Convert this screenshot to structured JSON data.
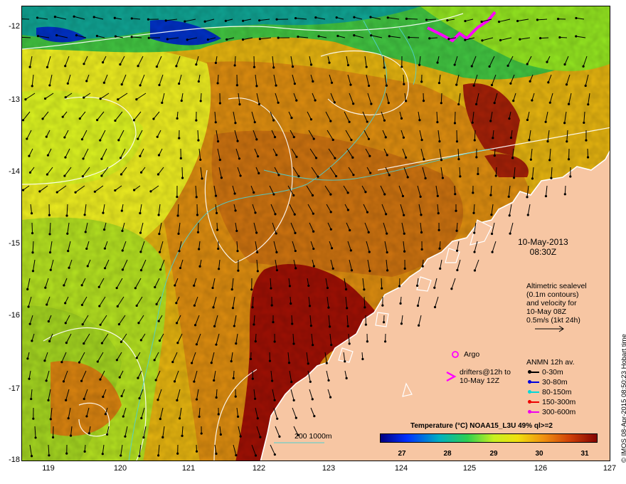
{
  "axes": {
    "y_ticks": [
      "-12",
      "-13",
      "-14",
      "-15",
      "-16",
      "-17",
      "-18"
    ],
    "x_ticks": [
      "119",
      "120",
      "121",
      "122",
      "123",
      "124",
      "125",
      "126",
      "127"
    ]
  },
  "date": "10-May-2013",
  "time": "08:30Z",
  "altimetry_lines": [
    "Altimetric sealevel",
    "(0.1m contours)",
    "and velocity for",
    "10-May 08Z",
    "0.5m/s (1kt 24h)"
  ],
  "argo_label": "Argo",
  "drifters_lines": [
    "drifters@12h to",
    "10-May 12Z"
  ],
  "anmn_title": "ANMN 12h av.",
  "anmn_legend": [
    {
      "label": "0-30m",
      "color": "#000000"
    },
    {
      "label": "30-80m",
      "color": "#0000dd"
    },
    {
      "label": "80-150m",
      "color": "#00d8d8"
    },
    {
      "label": "150-300m",
      "color": "#ee0000"
    },
    {
      "label": "300-600m",
      "color": "#ee00ee"
    }
  ],
  "isobath_label": "200  1000m",
  "colorbar": {
    "title": "Temperature (°C) NOAA15_L3U 49% ql>=2",
    "labels": [
      "27",
      "28",
      "29",
      "30",
      "31"
    ]
  },
  "timestamp": "© IMOS 08-Apr-2015 08:50:23 Hobart time",
  "colors": {
    "land": "#f7c6a3",
    "coast": "#ffffff",
    "isobath": "#4fd0d0"
  }
}
